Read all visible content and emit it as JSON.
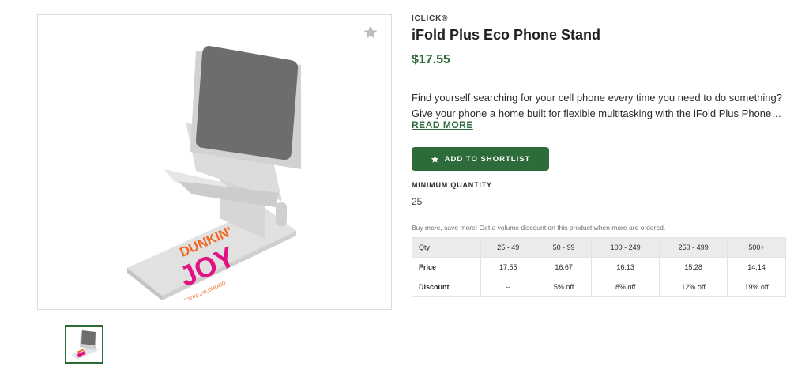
{
  "gallery": {
    "favorite_icon": "star-icon",
    "product_print": {
      "line1": "DUNKIN'",
      "line2": "JOY",
      "tagline": "#DUNKINJOYINCHILDHOOD"
    }
  },
  "product": {
    "brand": "ICLICK®",
    "title": "iFold Plus Eco Phone Stand",
    "price": "$17.55",
    "description_line1": "Find yourself searching for your cell phone every time you need to do something?",
    "description_line2": "Give your phone a home built for flexible multitasking with the iFold Plus Phone…",
    "read_more": "READ MORE"
  },
  "actions": {
    "shortlist_label": "ADD TO SHORTLIST",
    "shortlist_icon": "star-icon"
  },
  "minimum": {
    "label": "MINIMUM QUANTITY",
    "value": "25"
  },
  "pricing": {
    "note": "Buy more, save more! Get a volume discount on this product when more are ordered.",
    "headers": [
      "Qty",
      "25 - 49",
      "50 - 99",
      "100 - 249",
      "250 - 499",
      "500+"
    ],
    "price_row": [
      "Price",
      "17.55",
      "16.67",
      "16.13",
      "15.28",
      "14.14"
    ],
    "discount_row": [
      "Discount",
      "--",
      "5% off",
      "8% off",
      "12% off",
      "19% off"
    ]
  },
  "colors": {
    "accent": "#2e6b3a",
    "table_header_bg": "#e9ecea",
    "print_orange": "#f26722",
    "print_pink": "#e11383"
  }
}
